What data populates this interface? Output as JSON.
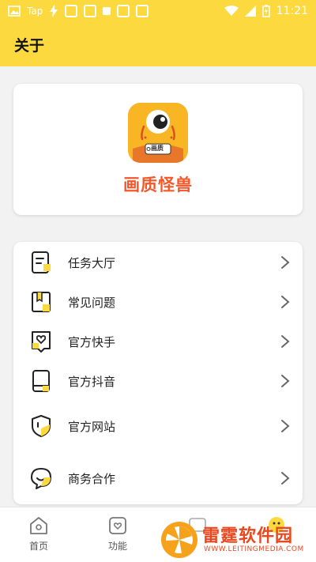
{
  "status_bar": {
    "left_text": "Tap",
    "time": "11:21"
  },
  "header": {
    "title": "关于"
  },
  "app": {
    "name": "画质怪兽",
    "logo_badge": "画质"
  },
  "menu": {
    "items": [
      {
        "label": "任务大厅",
        "icon": "task-icon"
      },
      {
        "label": "常见问题",
        "icon": "faq-book-icon"
      },
      {
        "label": "官方快手",
        "icon": "kuaishou-icon"
      },
      {
        "label": "官方抖音",
        "icon": "douyin-phone-icon"
      },
      {
        "label": "官方网站",
        "icon": "website-shield-icon"
      },
      {
        "label": "商务合作",
        "icon": "chat-bubble-icon"
      }
    ]
  },
  "bottom_nav": {
    "items": [
      {
        "label": "首页",
        "icon": "home-icon"
      },
      {
        "label": "功能",
        "icon": "function-icon"
      }
    ]
  },
  "watermark": {
    "title": "雷霆软件园",
    "url": "WWW.LEITINGMEDIA.COM"
  },
  "colors": {
    "accent": "#fbd93f",
    "brand_name": "#f4572a",
    "watermark": "#e8471f"
  }
}
